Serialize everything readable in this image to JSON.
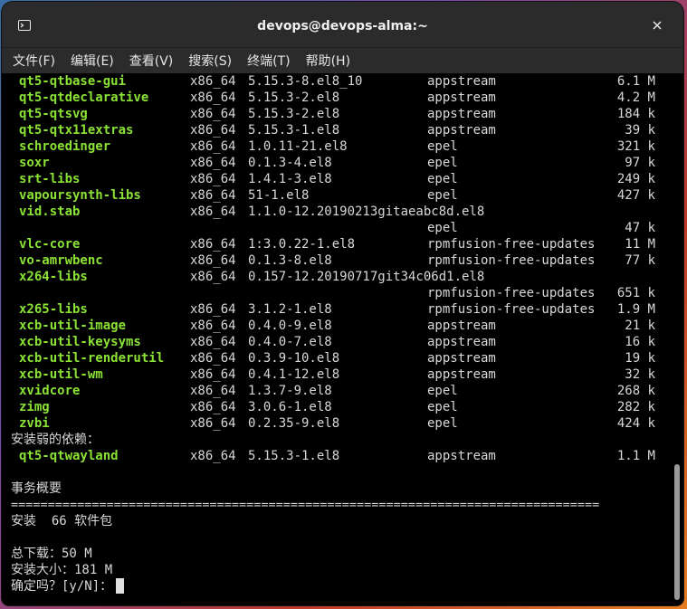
{
  "window": {
    "title": "devops@devops-alma:~"
  },
  "menu": [
    "文件(F)",
    "编辑(E)",
    "查看(V)",
    "搜索(S)",
    "终端(T)",
    "帮助(H)"
  ],
  "packages": [
    {
      "name": "qt5-qtbase-gui",
      "arch": "x86_64",
      "ver": "5.15.3-8.el8_10",
      "repo": "appstream",
      "size": "6.1 M"
    },
    {
      "name": "qt5-qtdeclarative",
      "arch": "x86_64",
      "ver": "5.15.3-2.el8",
      "repo": "appstream",
      "size": "4.2 M"
    },
    {
      "name": "qt5-qtsvg",
      "arch": "x86_64",
      "ver": "5.15.3-2.el8",
      "repo": "appstream",
      "size": "184 k"
    },
    {
      "name": "qt5-qtx11extras",
      "arch": "x86_64",
      "ver": "5.15.3-1.el8",
      "repo": "appstream",
      "size": "39 k"
    },
    {
      "name": "schroedinger",
      "arch": "x86_64",
      "ver": "1.0.11-21.el8",
      "repo": "epel",
      "size": "321 k"
    },
    {
      "name": "soxr",
      "arch": "x86_64",
      "ver": "0.1.3-4.el8",
      "repo": "epel",
      "size": "97 k"
    },
    {
      "name": "srt-libs",
      "arch": "x86_64",
      "ver": "1.4.1-3.el8",
      "repo": "epel",
      "size": "249 k"
    },
    {
      "name": "vapoursynth-libs",
      "arch": "x86_64",
      "ver": "51-1.el8",
      "repo": "epel",
      "size": "427 k"
    },
    {
      "name": "vid.stab",
      "arch": "x86_64",
      "ver": "1.1.0-12.20190213gitaeabc8d.el8",
      "repo": "",
      "size": ""
    },
    {
      "name": "",
      "arch": "",
      "ver": "",
      "repo": "epel",
      "size": "47 k"
    },
    {
      "name": "vlc-core",
      "arch": "x86_64",
      "ver": "1:3.0.22-1.el8",
      "repo": "rpmfusion-free-updates",
      "size": "11 M"
    },
    {
      "name": "vo-amrwbenc",
      "arch": "x86_64",
      "ver": "0.1.3-8.el8",
      "repo": "rpmfusion-free-updates",
      "size": "77 k"
    },
    {
      "name": "x264-libs",
      "arch": "x86_64",
      "ver": "0.157-12.20190717git34c06d1.el8",
      "repo": "",
      "size": ""
    },
    {
      "name": "",
      "arch": "",
      "ver": "",
      "repo": "rpmfusion-free-updates",
      "size": "651 k"
    },
    {
      "name": "x265-libs",
      "arch": "x86_64",
      "ver": "3.1.2-1.el8",
      "repo": "rpmfusion-free-updates",
      "size": "1.9 M"
    },
    {
      "name": "xcb-util-image",
      "arch": "x86_64",
      "ver": "0.4.0-9.el8",
      "repo": "appstream",
      "size": "21 k"
    },
    {
      "name": "xcb-util-keysyms",
      "arch": "x86_64",
      "ver": "0.4.0-7.el8",
      "repo": "appstream",
      "size": "16 k"
    },
    {
      "name": "xcb-util-renderutil",
      "arch": "x86_64",
      "ver": "0.3.9-10.el8",
      "repo": "appstream",
      "size": "19 k"
    },
    {
      "name": "xcb-util-wm",
      "arch": "x86_64",
      "ver": "0.4.1-12.el8",
      "repo": "appstream",
      "size": "32 k"
    },
    {
      "name": "xvidcore",
      "arch": "x86_64",
      "ver": "1.3.7-9.el8",
      "repo": "epel",
      "size": "268 k"
    },
    {
      "name": "zimg",
      "arch": "x86_64",
      "ver": "3.0.6-1.el8",
      "repo": "epel",
      "size": "282 k"
    },
    {
      "name": "zvbi",
      "arch": "x86_64",
      "ver": "0.2.35-9.el8",
      "repo": "epel",
      "size": "424 k"
    }
  ],
  "weak_deps_header": "安装弱的依赖：",
  "weak_deps": [
    {
      "name": "qt5-qtwayland",
      "arch": "x86_64",
      "ver": "5.15.3-1.el8",
      "repo": "appstream",
      "size": "1.1 M"
    }
  ],
  "summary": {
    "header": "事务概要",
    "rule": "================================================================================",
    "install_line": "安装  66 软件包",
    "download_total": "总下载：50 M",
    "install_size": "安装大小：181 M",
    "prompt": "确定吗？[y/N]："
  }
}
